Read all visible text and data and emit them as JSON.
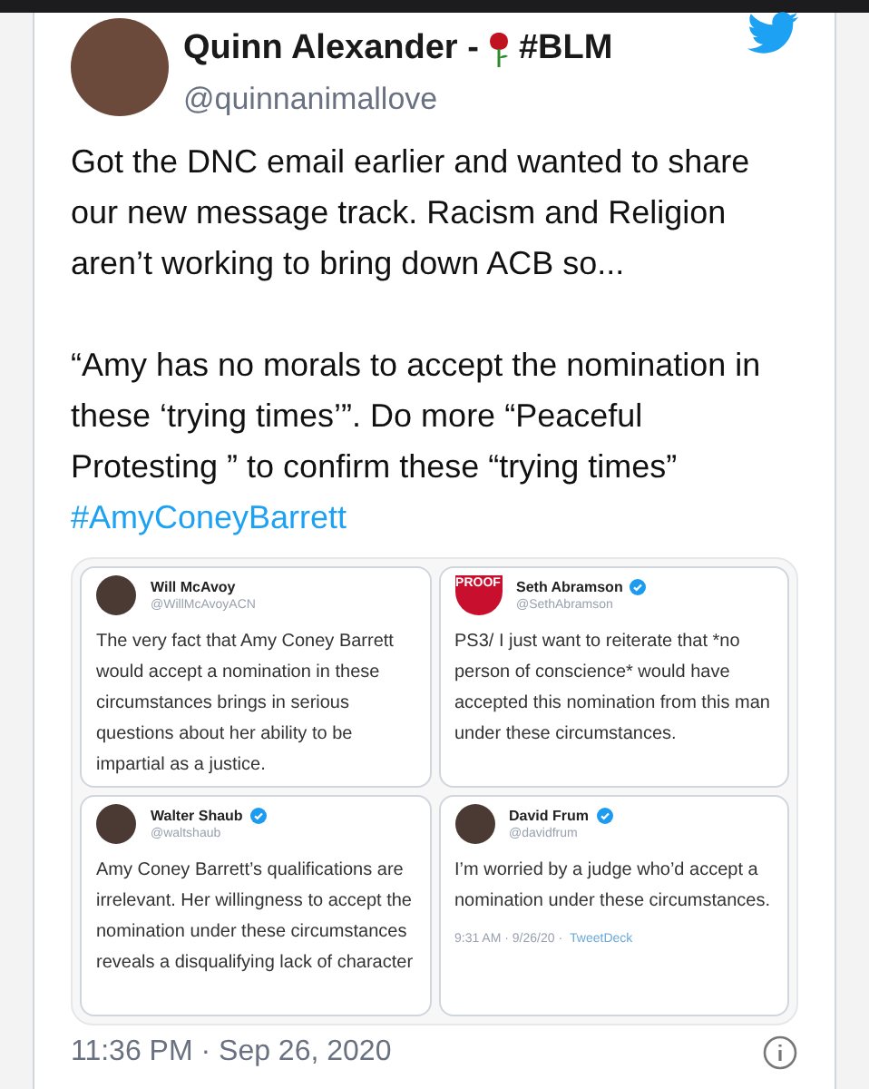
{
  "author": {
    "name": "Quinn Alexander -",
    "tag": "#BLM",
    "handle": "@quinnanimallove"
  },
  "paragraphs": [
    "Got the DNC email earlier and wanted to share our new message track. Racism and Religion aren’t working to bring down ACB so...",
    "“Amy has no morals to accept the nomination in these ‘trying times’”. Do more “Peaceful Protesting ” to confirm these “trying times”"
  ],
  "hashtag": "#AmyConeyBarrett",
  "embedded": [
    {
      "name": "Will McAvoy",
      "handle": "@WillMcAvoyACN",
      "verified": false,
      "text": "The very fact that Amy Coney Barrett would accept a nomination in these circumstances brings in serious questions about her ability to be impartial as a justice."
    },
    {
      "name": "Seth Abramson",
      "handle": "@SethAbramson",
      "verified": true,
      "logo": "PROOF",
      "text": "PS3/ I just want to reiterate that *no person of conscience* would have accepted this nomination from this man under these circumstances."
    },
    {
      "name": "Walter Shaub",
      "handle": "@waltshaub",
      "verified": true,
      "text": "Amy Coney Barrett’s qualifications are irrelevant. Her willingness to accept the nomination under these circumstances reveals a disqualifying lack of character"
    },
    {
      "name": "David Frum",
      "handle": "@davidfrum",
      "verified": true,
      "text": "I’m worried by a judge who’d accept a nomination under these circumstances.",
      "meta": "9:31 AM · 9/26/20 ·",
      "source": "TweetDeck"
    }
  ],
  "timestamp": "11:36 PM · Sep 26, 2020"
}
